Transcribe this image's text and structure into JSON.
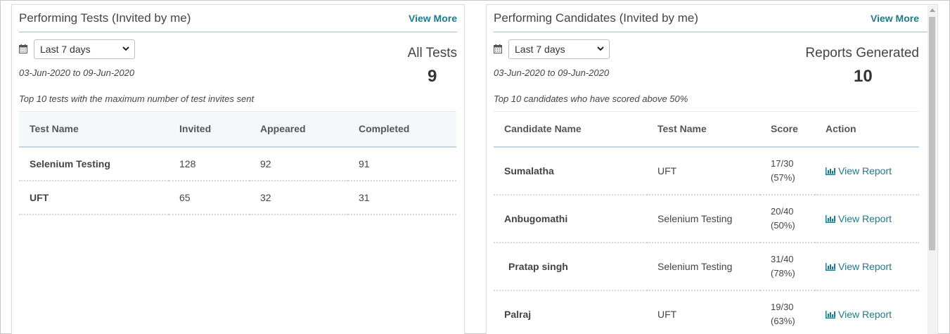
{
  "tests_panel": {
    "title": "Performing Tests (Invited by me)",
    "view_more": "View More",
    "period_select": "Last 7 days",
    "date_range": "03-Jun-2020 to 09-Jun-2020",
    "stat_label": "All Tests",
    "stat_value": "9",
    "caption": "Top 10 tests with the maximum number of test invites sent",
    "columns": [
      "Test Name",
      "Invited",
      "Appeared",
      "Completed"
    ],
    "rows": [
      {
        "name": "Selenium Testing",
        "invited": "128",
        "appeared": "92",
        "completed": "91"
      },
      {
        "name": "UFT",
        "invited": "65",
        "appeared": "32",
        "completed": "31"
      }
    ]
  },
  "candidates_panel": {
    "title": "Performing Candidates (Invited by me)",
    "view_more": "View More",
    "period_select": "Last 7 days",
    "date_range": "03-Jun-2020 to 09-Jun-2020",
    "stat_label": "Reports Generated",
    "stat_value": "10",
    "caption": "Top 10 candidates who have scored above 50%",
    "columns": [
      "Candidate Name",
      "Test Name",
      "Score",
      "Action"
    ],
    "rows": [
      {
        "name": "Sumalatha",
        "test": "UFT",
        "score": "17/30",
        "percent": "(57%)",
        "action": "View Report"
      },
      {
        "name": "Anbugomathi",
        "test": "Selenium Testing",
        "score": "20/40",
        "percent": "(50%)",
        "action": "View Report"
      },
      {
        "name": "Pratap singh",
        "test": "Selenium Testing",
        "score": "31/40",
        "percent": "(78%)",
        "action": "View Report"
      },
      {
        "name": "Palraj",
        "test": "UFT",
        "score": "19/30",
        "percent": "(63%)",
        "action": "View Report"
      }
    ]
  },
  "icons": {
    "calendar": "calendar-icon",
    "dropdown": "chevron-down-icon",
    "report": "bar-chart-icon"
  },
  "colors": {
    "accent": "#1f7a8c"
  }
}
